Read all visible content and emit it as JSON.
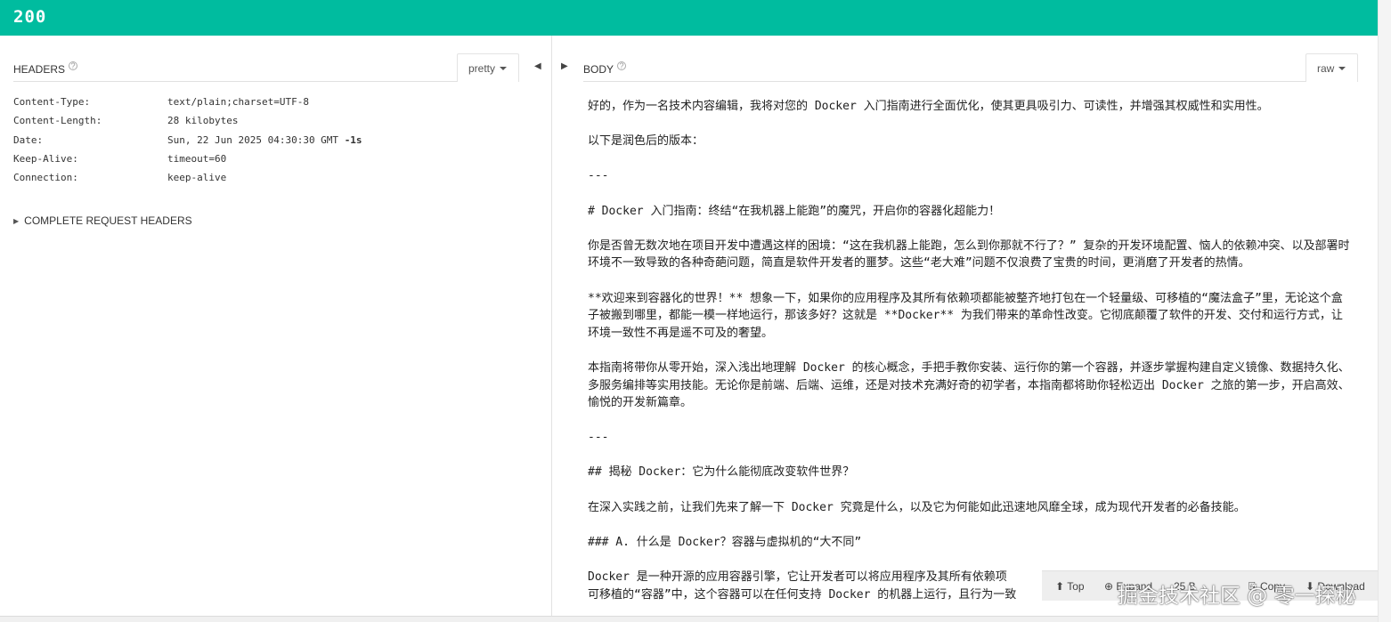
{
  "status": {
    "code": "200",
    "color": "#00bc9f"
  },
  "headers_pane": {
    "title": "HEADERS",
    "format": "pretty",
    "rows": [
      {
        "key": "Content-Type:",
        "value": "text/plain;charset=UTF-8",
        "extra": ""
      },
      {
        "key": "Content-Length:",
        "value": "28 kilobytes",
        "extra": ""
      },
      {
        "key": "Date:",
        "value": "Sun, 22 Jun 2025 04:30:30 GMT ",
        "extra": "-1s"
      },
      {
        "key": "Keep-Alive:",
        "value": "timeout=60",
        "extra": ""
      },
      {
        "key": "Connection:",
        "value": "keep-alive",
        "extra": ""
      }
    ],
    "complete_request_label": "COMPLETE REQUEST HEADERS"
  },
  "body_pane": {
    "title": "BODY",
    "format": "raw",
    "paragraphs": [
      "好的，作为一名技术内容编辑，我将对您的 Docker 入门指南进行全面优化，使其更具吸引力、可读性，并增强其权威性和实用性。",
      "以下是润色后的版本：",
      "---",
      "# Docker 入门指南：终结“在我机器上能跑”的魔咒，开启你的容器化超能力！",
      "你是否曾无数次地在项目开发中遭遇这样的困境：“这在我机器上能跑，怎么到你那就不行了？” 复杂的开发环境配置、恼人的依赖冲突、以及部署时环境不一致导致的各种奇葩问题，简直是软件开发者的噩梦。这些“老大难”问题不仅浪费了宝贵的时间，更消磨了开发者的热情。",
      "**欢迎来到容器化的世界！** 想象一下，如果你的应用程序及其所有依赖项都能被整齐地打包在一个轻量级、可移植的“魔法盒子”里，无论这个盒子被搬到哪里，都能一模一样地运行，那该多好？这就是 **Docker** 为我们带来的革命性改变。它彻底颠覆了软件的开发、交付和运行方式，让环境一致性不再是遥不可及的奢望。",
      "本指南将带你从零开始，深入浅出地理解 Docker 的核心概念，手把手教你安装、运行你的第一个容器，并逐步掌握构建自定义镜像、数据持久化、多服务编排等实用技能。无论你是前端、后端、运维，还是对技术充满好奇的初学者，本指南都将助你轻松迈出 Docker 之旅的第一步，开启高效、愉悦的开发新篇章。",
      "---",
      "## 揭秘 Docker：它为什么能彻底改变软件世界？",
      "在深入实践之前，让我们先来了解一下 Docker 究竟是什么，以及它为何能如此迅速地风靡全球，成为现代开发者的必备技能。",
      "### A. 什么是 Docker？容器与虚拟机的“大不同”",
      "Docker 是一种开源的应用容器引擎，它让开发者可以将应用程序及其所有依赖项",
      "可移植的“容器”中，这个容器可以在任何支持 Docker 的机器上运行，且行为一致"
    ]
  },
  "footer": {
    "top_label": "Top",
    "expand_label": "Expand",
    "size_label": "25 B",
    "copy_label": "Copy",
    "download_label": "Download"
  },
  "watermark": "掘金技术社区 @ 零一探秘"
}
